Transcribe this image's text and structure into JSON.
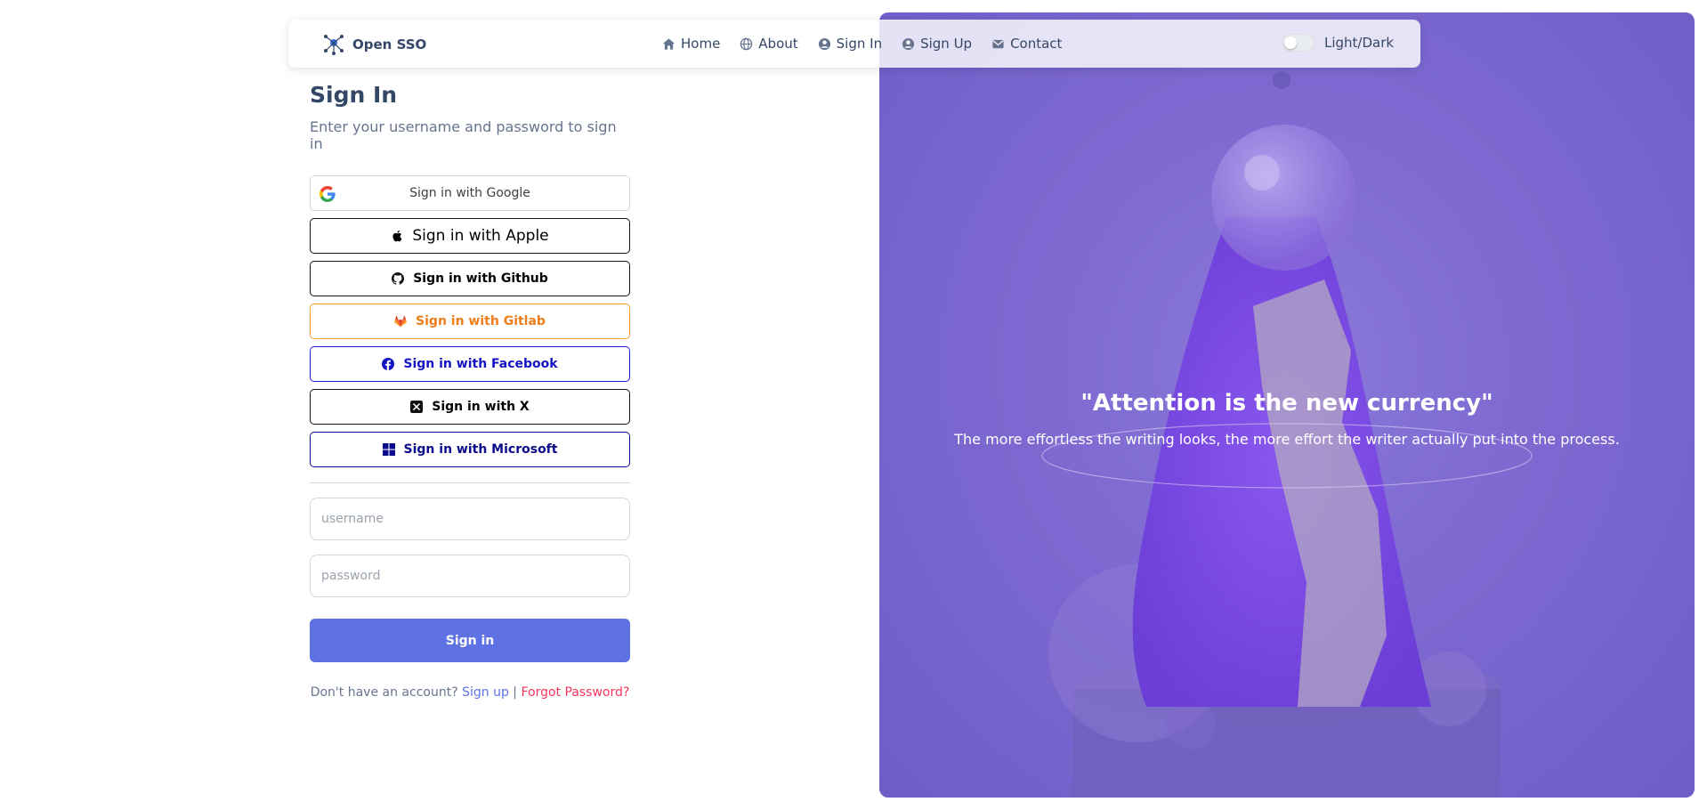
{
  "brand": {
    "name": "Open SSO",
    "icon": "network-logo-icon"
  },
  "nav": {
    "items": [
      {
        "label": "Home",
        "icon": "home-icon"
      },
      {
        "label": "About",
        "icon": "globe-icon"
      },
      {
        "label": "Sign In",
        "icon": "user-circle-icon"
      },
      {
        "label": "Sign Up",
        "icon": "user-circle-icon"
      },
      {
        "label": "Contact",
        "icon": "envelope-icon"
      }
    ],
    "theme_label": "Light/Dark"
  },
  "form": {
    "title": "Sign In",
    "subtitle": "Enter your username and password to sign in",
    "sso": {
      "google": "Sign in with Google",
      "apple": "Sign in with Apple",
      "github": "Sign in with Github",
      "gitlab": "Sign in with Gitlab",
      "facebook": "Sign in with Facebook",
      "x": "Sign in with X",
      "microsoft": "Sign in with Microsoft"
    },
    "username_placeholder": "username",
    "password_placeholder": "password",
    "submit_label": "Sign in",
    "footer_text": "Don't have an account?",
    "signup_link": "Sign up",
    "separator": "|",
    "forgot_link": "Forgot Password?"
  },
  "hero": {
    "quote": "\"Attention is the new currency\"",
    "subtext": "The more effortless the writing looks, the more effort the writer actually put into the process."
  },
  "colors": {
    "primary": "#5e72e4",
    "danger": "#f5365c",
    "hero_bg": "#7e6ad1",
    "gitlab": "#ee7d1a",
    "facebook": "#1414c4",
    "microsoft": "#0a0a8c"
  }
}
